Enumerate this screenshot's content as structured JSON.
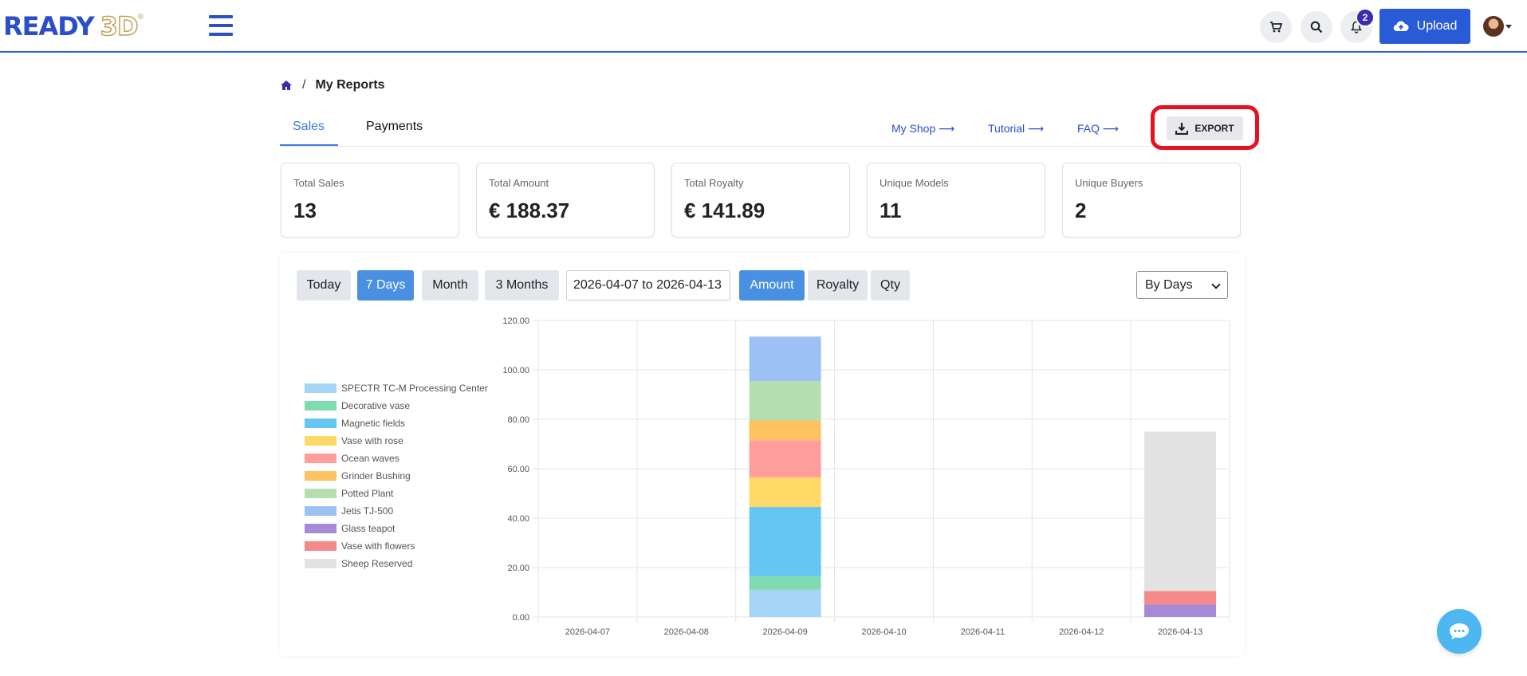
{
  "header": {
    "logo_text_main": "READY",
    "logo_text_accent": "3D",
    "logo_reg": "®",
    "notification_count": "2",
    "upload_label": "Upload"
  },
  "breadcrumb": {
    "separator": "/",
    "current": "My Reports"
  },
  "tabs": [
    {
      "label": "Sales",
      "active": true
    },
    {
      "label": "Payments",
      "active": false
    }
  ],
  "links": {
    "my_shop": "My Shop ⟶",
    "tutorial": "Tutorial ⟶",
    "faq": "FAQ ⟶"
  },
  "export_label": "EXPORT",
  "stats": [
    {
      "label": "Total Sales",
      "value": "13"
    },
    {
      "label": "Total Amount",
      "value": "€ 188.37"
    },
    {
      "label": "Total Royalty",
      "value": "€ 141.89"
    },
    {
      "label": "Unique Models",
      "value": "11"
    },
    {
      "label": "Unique Buyers",
      "value": "2"
    }
  ],
  "filters": {
    "periods": [
      "Today",
      "7 Days",
      "Month",
      "3 Months"
    ],
    "active_period": "7 Days",
    "date_range": "2026-04-07 to 2026-04-13",
    "metrics": [
      "Amount",
      "Royalty",
      "Qty"
    ],
    "active_metric": "Amount",
    "group_by": "By Days"
  },
  "chart_data": {
    "type": "bar",
    "stacked": true,
    "categories": [
      "2026-04-07",
      "2026-04-08",
      "2026-04-09",
      "2026-04-10",
      "2026-04-11",
      "2026-04-12",
      "2026-04-13"
    ],
    "ylim": [
      0,
      120
    ],
    "yticks": [
      "0.00",
      "20.00",
      "40.00",
      "60.00",
      "80.00",
      "100.00",
      "120.00"
    ],
    "grid": true,
    "legend_position": "left",
    "series": [
      {
        "name": "SPECTR TC-M Processing Center",
        "color": "#a4d5f5",
        "values": [
          0,
          0,
          11,
          0,
          0,
          0,
          0
        ]
      },
      {
        "name": "Decorative vase",
        "color": "#7fdcb1",
        "values": [
          0,
          0,
          5.5,
          0,
          0,
          0,
          0
        ]
      },
      {
        "name": "Magnetic fields",
        "color": "#63c6f3",
        "values": [
          0,
          0,
          28,
          0,
          0,
          0,
          0
        ]
      },
      {
        "name": "Vase with rose",
        "color": "#ffd966",
        "values": [
          0,
          0,
          12,
          0,
          0,
          0,
          0
        ]
      },
      {
        "name": "Ocean waves",
        "color": "#ff9c9c",
        "values": [
          0,
          0,
          15,
          0,
          0,
          0,
          0
        ]
      },
      {
        "name": "Grinder Bushing",
        "color": "#ffc261",
        "values": [
          0,
          0,
          8,
          0,
          0,
          0,
          0
        ]
      },
      {
        "name": "Potted Plant",
        "color": "#b5dfb0",
        "values": [
          0,
          0,
          16,
          0,
          0,
          0,
          0
        ]
      },
      {
        "name": "Jetis TJ-500",
        "color": "#9ec1f5",
        "values": [
          0,
          0,
          18,
          0,
          0,
          0,
          0
        ]
      },
      {
        "name": "Glass teapot",
        "color": "#a58ad6",
        "values": [
          0,
          0,
          0,
          0,
          0,
          0,
          5
        ]
      },
      {
        "name": "Vase with flowers",
        "color": "#f58a8a",
        "values": [
          0,
          0,
          0,
          0,
          0,
          0,
          5.5
        ]
      },
      {
        "name": "Sheep Reserved",
        "color": "#e2e2e2",
        "values": [
          0,
          0,
          0,
          0,
          0,
          0,
          64.5
        ]
      }
    ]
  },
  "colors": {
    "brand": "#2a5bd7",
    "accent": "#4a90e2",
    "export_highlight": "#e8121f",
    "chat": "#4cb7f0"
  }
}
